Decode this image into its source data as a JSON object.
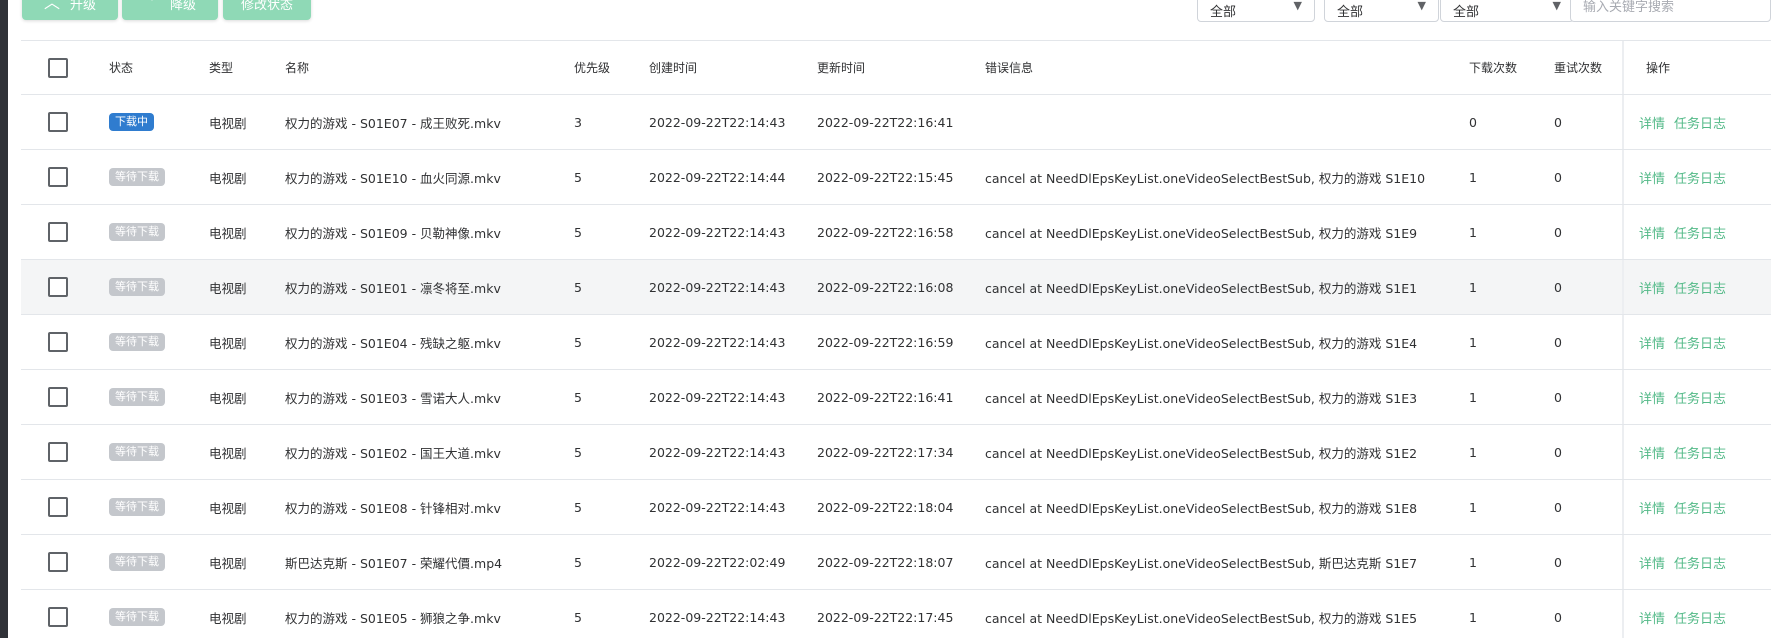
{
  "toolbar": {
    "upgrade_label": "升级",
    "downgrade_label": "降级",
    "modify_status_label": "修改状态",
    "filter1_value": "全部",
    "filter2_value": "全部",
    "filter3_value": "全部",
    "search_placeholder": "输入关键字搜索"
  },
  "columns": {
    "status": "状态",
    "type": "类型",
    "name": "名称",
    "priority": "优先级",
    "created": "创建时间",
    "updated": "更新时间",
    "error": "错误信息",
    "downloads": "下载次数",
    "retries": "重试次数",
    "ops": "操作"
  },
  "actions": {
    "detail": "详情",
    "log": "任务日志"
  },
  "colors": {
    "accent": "#52b987",
    "status_active": "#2f7ccf",
    "status_waiting": "#c4c7cc"
  },
  "rows": [
    {
      "status": "下载中",
      "status_kind": "blue",
      "type": "电视剧",
      "name": "权力的游戏 - S01E07 - 成王败死.mkv",
      "priority": "3",
      "created": "2022-09-22T22:14:43",
      "updated": "2022-09-22T22:16:41",
      "error": "",
      "downloads": "0",
      "retries": "0"
    },
    {
      "status": "等待下载",
      "status_kind": "grey",
      "type": "电视剧",
      "name": "权力的游戏 - S01E10 - 血火同源.mkv",
      "priority": "5",
      "created": "2022-09-22T22:14:44",
      "updated": "2022-09-22T22:15:45",
      "error": "cancel at NeedDlEpsKeyList.oneVideoSelectBestSub, 权力的游戏 S1E10",
      "downloads": "1",
      "retries": "0"
    },
    {
      "status": "等待下载",
      "status_kind": "grey",
      "type": "电视剧",
      "name": "权力的游戏 - S01E09 - 贝勒神像.mkv",
      "priority": "5",
      "created": "2022-09-22T22:14:43",
      "updated": "2022-09-22T22:16:58",
      "error": "cancel at NeedDlEpsKeyList.oneVideoSelectBestSub, 权力的游戏 S1E9",
      "downloads": "1",
      "retries": "0"
    },
    {
      "status": "等待下载",
      "status_kind": "grey",
      "type": "电视剧",
      "name": "权力的游戏 - S01E01 - 凛冬将至.mkv",
      "priority": "5",
      "created": "2022-09-22T22:14:43",
      "updated": "2022-09-22T22:16:08",
      "error": "cancel at NeedDlEpsKeyList.oneVideoSelectBestSub, 权力的游戏 S1E1",
      "downloads": "1",
      "retries": "0"
    },
    {
      "status": "等待下载",
      "status_kind": "grey",
      "type": "电视剧",
      "name": "权力的游戏 - S01E04 - 残缺之躯.mkv",
      "priority": "5",
      "created": "2022-09-22T22:14:43",
      "updated": "2022-09-22T22:16:59",
      "error": "cancel at NeedDlEpsKeyList.oneVideoSelectBestSub, 权力的游戏 S1E4",
      "downloads": "1",
      "retries": "0"
    },
    {
      "status": "等待下载",
      "status_kind": "grey",
      "type": "电视剧",
      "name": "权力的游戏 - S01E03 - 雪诺大人.mkv",
      "priority": "5",
      "created": "2022-09-22T22:14:43",
      "updated": "2022-09-22T22:16:41",
      "error": "cancel at NeedDlEpsKeyList.oneVideoSelectBestSub, 权力的游戏 S1E3",
      "downloads": "1",
      "retries": "0"
    },
    {
      "status": "等待下载",
      "status_kind": "grey",
      "type": "电视剧",
      "name": "权力的游戏 - S01E02 - 国王大道.mkv",
      "priority": "5",
      "created": "2022-09-22T22:14:43",
      "updated": "2022-09-22T22:17:34",
      "error": "cancel at NeedDlEpsKeyList.oneVideoSelectBestSub, 权力的游戏 S1E2",
      "downloads": "1",
      "retries": "0"
    },
    {
      "status": "等待下载",
      "status_kind": "grey",
      "type": "电视剧",
      "name": "权力的游戏 - S01E08 - 针锋相对.mkv",
      "priority": "5",
      "created": "2022-09-22T22:14:43",
      "updated": "2022-09-22T22:18:04",
      "error": "cancel at NeedDlEpsKeyList.oneVideoSelectBestSub, 权力的游戏 S1E8",
      "downloads": "1",
      "retries": "0"
    },
    {
      "status": "等待下载",
      "status_kind": "grey",
      "type": "电视剧",
      "name": "斯巴达克斯 - S01E07 - 荣耀代價.mp4",
      "priority": "5",
      "created": "2022-09-22T22:02:49",
      "updated": "2022-09-22T22:18:07",
      "error": "cancel at NeedDlEpsKeyList.oneVideoSelectBestSub, 斯巴达克斯 S1E7",
      "downloads": "1",
      "retries": "0"
    },
    {
      "status": "等待下载",
      "status_kind": "grey",
      "type": "电视剧",
      "name": "权力的游戏 - S01E05 - 狮狼之争.mkv",
      "priority": "5",
      "created": "2022-09-22T22:14:43",
      "updated": "2022-09-22T22:17:45",
      "error": "cancel at NeedDlEpsKeyList.oneVideoSelectBestSub, 权力的游戏 S1E5",
      "downloads": "1",
      "retries": "0"
    }
  ]
}
